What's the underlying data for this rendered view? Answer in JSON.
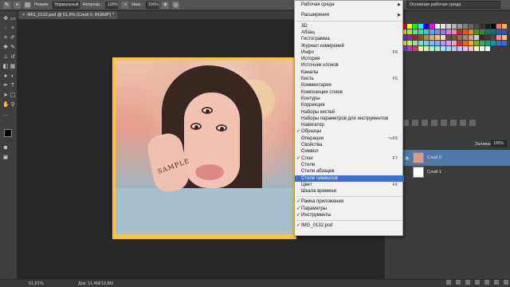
{
  "options_bar": {
    "mode_label": "Режим:",
    "mode_value": "Нормальный",
    "opacity_label": "Непрозр.:",
    "opacity_value": "100%",
    "pressure_label": "Наж.:",
    "pressure_value": "100%",
    "workspace_value": "Основная рабочая среда"
  },
  "document_tab": {
    "title": "IMG_0132.psd @ 51,8% (Слой 0, RGB/8*) *",
    "close_glyph": "×"
  },
  "photo": {
    "hand_text": "SAMPLE"
  },
  "status_bar": {
    "zoom": "51,81%",
    "doc_size": "Док: 11,4М/19,8М"
  },
  "layers": {
    "lock_label": "Заливка:",
    "lock_value": "100%",
    "rows": [
      {
        "name": "Слой 0",
        "selected": true
      },
      {
        "name": "Слой 1",
        "selected": false
      }
    ]
  },
  "menu": {
    "top_items": [
      {
        "label": "Рабочая среда",
        "submenu": true
      },
      {
        "label": "Расширения",
        "submenu": true
      }
    ],
    "items": [
      {
        "label": "3D",
        "shortcut": "",
        "checked": false
      },
      {
        "label": "Абзац",
        "shortcut": "",
        "checked": false
      },
      {
        "label": "Гистограмма",
        "shortcut": "",
        "checked": false
      },
      {
        "label": "Журнал измерений",
        "shortcut": "",
        "checked": false
      },
      {
        "label": "Инфо",
        "shortcut": "F8",
        "checked": false
      },
      {
        "label": "История",
        "shortcut": "",
        "checked": false
      },
      {
        "label": "Источник клонов",
        "shortcut": "",
        "checked": false
      },
      {
        "label": "Каналы",
        "shortcut": "",
        "checked": false
      },
      {
        "label": "Кисть",
        "shortcut": "F5",
        "checked": false
      },
      {
        "label": "Комментарии",
        "shortcut": "",
        "checked": false
      },
      {
        "label": "Композиции слоев",
        "shortcut": "",
        "checked": false
      },
      {
        "label": "Контуры",
        "shortcut": "",
        "checked": false
      },
      {
        "label": "Коррекция",
        "shortcut": "",
        "checked": false
      },
      {
        "label": "Наборы кистей",
        "shortcut": "",
        "checked": false
      },
      {
        "label": "Наборы параметров для инструментов",
        "shortcut": "",
        "checked": false
      },
      {
        "label": "Навигатор",
        "shortcut": "",
        "checked": false
      },
      {
        "label": "Образцы",
        "shortcut": "",
        "checked": true
      },
      {
        "label": "Операции",
        "shortcut": "⌥F9",
        "checked": false
      },
      {
        "label": "Свойства",
        "shortcut": "",
        "checked": false
      },
      {
        "label": "Символ",
        "shortcut": "",
        "checked": false
      },
      {
        "label": "Слои",
        "shortcut": "F7",
        "checked": true
      },
      {
        "label": "Стили",
        "shortcut": "",
        "checked": false
      },
      {
        "label": "Стили абзацев",
        "shortcut": "",
        "checked": false
      },
      {
        "label": "Стили символов",
        "shortcut": "",
        "checked": false,
        "highlighted": true
      },
      {
        "label": "Цвет",
        "shortcut": "F6",
        "checked": false
      },
      {
        "label": "Шкала времени",
        "shortcut": "",
        "checked": false
      }
    ],
    "bottom_items": [
      {
        "label": "Рамка приложения",
        "checked": true
      },
      {
        "label": "Параметры",
        "checked": true
      },
      {
        "label": "Инструменты",
        "checked": true
      }
    ],
    "document_item": {
      "label": "IMG_0132.psd",
      "checked": true
    }
  },
  "colors": {
    "menu_highlight": "#3b6fd1",
    "layer_selected": "#4d78a8",
    "photo_border": "#f7c63f"
  },
  "swatch_colors": [
    "#ff0000",
    "#ffff00",
    "#00ff00",
    "#00ffff",
    "#0000ff",
    "#ff00ff",
    "#ffffff",
    "#e6e6e6",
    "#cccccc",
    "#b3b3b3",
    "#999999",
    "#808080",
    "#666666",
    "#4d4d4d",
    "#333333",
    "#1a1a1a",
    "#000000",
    "#ff6b6b",
    "#ffa94d",
    "#ffd43b",
    "#a9e34b",
    "#69db7c",
    "#38d9a9",
    "#3bc9db",
    "#4dabf7",
    "#748ffc",
    "#9775fa",
    "#da77f2",
    "#f783ac",
    "#c92a2a",
    "#e8590c",
    "#f08c00",
    "#5c940d",
    "#2b8a3e",
    "#087f5b",
    "#0b7285",
    "#1864ab",
    "#364fc7",
    "#5f3dc4",
    "#862e9c",
    "#a61e4d",
    "#8d5524",
    "#c68642",
    "#e0ac69",
    "#f1c27d",
    "#ffdbac",
    "#6d4c41",
    "#795548",
    "#8d6e63",
    "#a1887f",
    "#bcaaa4",
    "#d7ccc8",
    "#3e2723",
    "#4e342e",
    "#5d4037",
    "#ff8787",
    "#ffc078",
    "#ffe066",
    "#c0eb75",
    "#8ce99a",
    "#63e6be",
    "#66d9e8",
    "#74c0fc",
    "#91a7ff",
    "#b197fc",
    "#e599f7",
    "#faa2c1",
    "#e03131",
    "#f76707",
    "#fab005",
    "#74b816",
    "#37b24d",
    "#0ca678",
    "#1098ad",
    "#1c7ed6",
    "#4263eb",
    "#7048e8",
    "#ae3ec9",
    "#d6336c",
    "#ffec99",
    "#d8f5a2",
    "#b2f2bb",
    "#96f2d7",
    "#99e9f2",
    "#a5d8ff",
    "#bac8ff",
    "#d0bfff",
    "#eebefa",
    "#fcc2d7",
    "#fff3bf",
    "#ebfbee",
    "#e6fcf5"
  ]
}
